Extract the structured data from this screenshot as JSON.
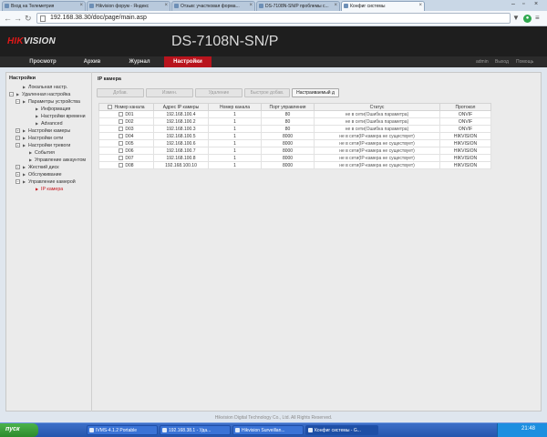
{
  "browser": {
    "tabs": [
      {
        "label": "Вход на Телеметрия"
      },
      {
        "label": "Hikvision форум - Яндекс"
      },
      {
        "label": "Отзыв: участковая форма..."
      },
      {
        "label": "DS-7108N-SN/P проблемы с..."
      },
      {
        "label": "Конфиг системы",
        "active": true
      }
    ],
    "url": "192.168.38.30/doc/page/main.asp"
  },
  "app": {
    "logo_left": "HIK",
    "logo_right": "VISION",
    "model": "DS-7108N-SN/P",
    "nav": [
      "Просмотр",
      "Архив",
      "Журнал",
      "Настройки"
    ],
    "active_nav": "Настройки",
    "user_links": [
      "admin",
      "Выход",
      "Помощь"
    ]
  },
  "sidebar": {
    "title": "Настройки",
    "items": [
      {
        "label": "Локальная настр.",
        "level": 1,
        "type": "arrow"
      },
      {
        "label": "Удаленная настройка",
        "level": 0,
        "type": "expanded"
      },
      {
        "label": "Параметры устройства",
        "level": 1,
        "type": "expanded"
      },
      {
        "label": "Информация",
        "level": 3,
        "type": "arrow"
      },
      {
        "label": "Настройки времени",
        "level": 3,
        "type": "arrow"
      },
      {
        "label": "Advanced",
        "level": 3,
        "type": "arrow"
      },
      {
        "label": "Настройки камеры",
        "level": 1,
        "type": "collapsed"
      },
      {
        "label": "Настройки сети",
        "level": 1,
        "type": "collapsed"
      },
      {
        "label": "Настройки тревоги",
        "level": 1,
        "type": "collapsed"
      },
      {
        "label": "События",
        "level": 2,
        "type": "arrow"
      },
      {
        "label": "Управление аккаунтом",
        "level": 2,
        "type": "arrow"
      },
      {
        "label": "Жесткий диск",
        "level": 1,
        "type": "collapsed"
      },
      {
        "label": "Обслуживание",
        "level": 1,
        "type": "collapsed"
      },
      {
        "label": "Управление камерой",
        "level": 1,
        "type": "expanded"
      },
      {
        "label": "IP камера",
        "level": 3,
        "type": "arrow",
        "selected": true
      }
    ]
  },
  "panel": {
    "title": "IP камера",
    "buttons": [
      {
        "label": "Добав.",
        "enabled": false
      },
      {
        "label": "Измен.",
        "enabled": false
      },
      {
        "label": "Удаление",
        "enabled": false
      },
      {
        "label": "Быстрое добав.",
        "enabled": false
      },
      {
        "label": "Настраиваемый д",
        "enabled": true
      }
    ],
    "columns": [
      "Номер канала",
      "Адрес IP камеры",
      "Номер канала",
      "Порт управления",
      "Статус",
      "Протокол"
    ],
    "rows": [
      [
        "D01",
        "192.168.100.4",
        "1",
        "80",
        "не в сети(Ошибка параметра)",
        "ONVIF"
      ],
      [
        "D02",
        "192.168.100.2",
        "1",
        "80",
        "не в сети(Ошибка параметра)",
        "ONVIF"
      ],
      [
        "D03",
        "192.168.100.3",
        "1",
        "80",
        "не в сети(Ошибка параметра)",
        "ONVIF"
      ],
      [
        "D04",
        "192.168.100.5",
        "1",
        "8000",
        "не в сети(IP-камера не существует)",
        "HIKVISION"
      ],
      [
        "D05",
        "192.168.100.6",
        "1",
        "8000",
        "не в сети(IP-камера не существует)",
        "HIKVISION"
      ],
      [
        "D06",
        "192.168.100.7",
        "1",
        "8000",
        "не в сети(IP-камера не существует)",
        "HIKVISION"
      ],
      [
        "D07",
        "192.168.100.8",
        "1",
        "8000",
        "не в сети(IP-камера не существует)",
        "HIKVISION"
      ],
      [
        "D08",
        "192.168.100.10",
        "1",
        "8000",
        "не в сети(IP-камера не существует)",
        "HIKVISION"
      ]
    ]
  },
  "footer": "Hikvision Digital Technology Co., Ltd. All Rights Reserved.",
  "taskbar": {
    "start": "пуск",
    "items": [
      {
        "label": "IVMS-4.1.2 Portable"
      },
      {
        "label": "192.168.38.1 - Уда..."
      },
      {
        "label": "Hikvision Surveillan..."
      },
      {
        "label": "Конфиг системы - G...",
        "active": true
      }
    ],
    "clock": "21:48"
  },
  "colors": {
    "accent_red": "#b8141d",
    "header_bg": "#1e1e1e",
    "selected_text": "#c8141c",
    "taskbar_blue": "#2556ad"
  }
}
